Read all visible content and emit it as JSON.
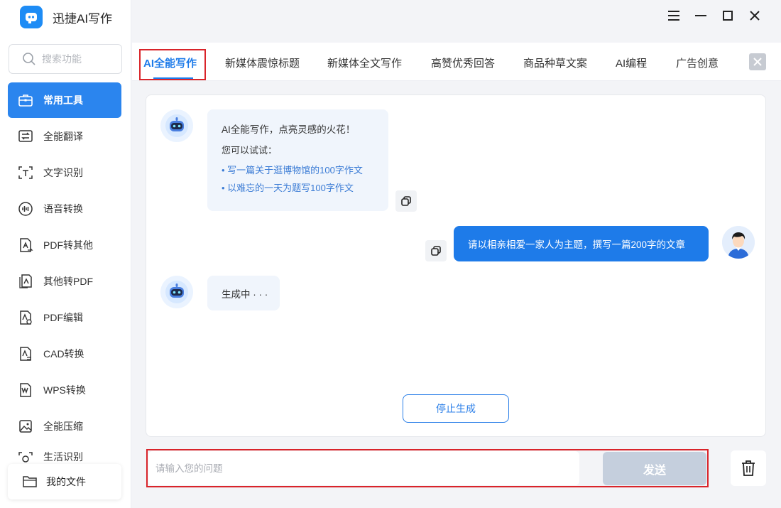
{
  "app": {
    "title": "迅捷AI写作",
    "logo_icon": "robot-logo-icon",
    "brand_color": "#1e7be9"
  },
  "sidebar": {
    "search_placeholder": "搜索功能",
    "items": [
      {
        "label": "常用工具",
        "icon": "toolbox-icon",
        "active": true
      },
      {
        "label": "全能翻译",
        "icon": "translate-icon"
      },
      {
        "label": "文字识别",
        "icon": "text-recognition-icon"
      },
      {
        "label": "语音转换",
        "icon": "voice-convert-icon"
      },
      {
        "label": "PDF转其他",
        "icon": "pdf-convert-icon"
      },
      {
        "label": "其他转PDF",
        "icon": "to-pdf-icon"
      },
      {
        "label": "PDF编辑",
        "icon": "pdf-edit-icon"
      },
      {
        "label": "CAD转换",
        "icon": "cad-convert-icon"
      },
      {
        "label": "WPS转换",
        "icon": "wps-convert-icon"
      },
      {
        "label": "全能压缩",
        "icon": "compress-icon"
      },
      {
        "label": "生活识别",
        "icon": "life-recognition-icon"
      }
    ],
    "my_files": "我的文件"
  },
  "tabs": [
    {
      "label": "AI全能写作",
      "active": true
    },
    {
      "label": "新媒体震惊标题"
    },
    {
      "label": "新媒体全文写作"
    },
    {
      "label": "高赞优秀回答"
    },
    {
      "label": "商品种草文案"
    },
    {
      "label": "AI编程"
    },
    {
      "label": "广告创意"
    }
  ],
  "chat": {
    "bot_intro": {
      "line1": "AI全能写作，点亮灵感的火花！",
      "line2": "您可以试试：",
      "suggestions": [
        "• 写一篇关于逛博物馆的100字作文",
        "• 以难忘的一天为题写100字作文"
      ]
    },
    "user_message": "请以相亲相爱一家人为主题，撰写一篇200字的文章",
    "bot_generating": "生成中 · · ·",
    "stop_label": "停止生成"
  },
  "input": {
    "placeholder": "请输入您的问题",
    "value": "",
    "send_label": "发送"
  }
}
